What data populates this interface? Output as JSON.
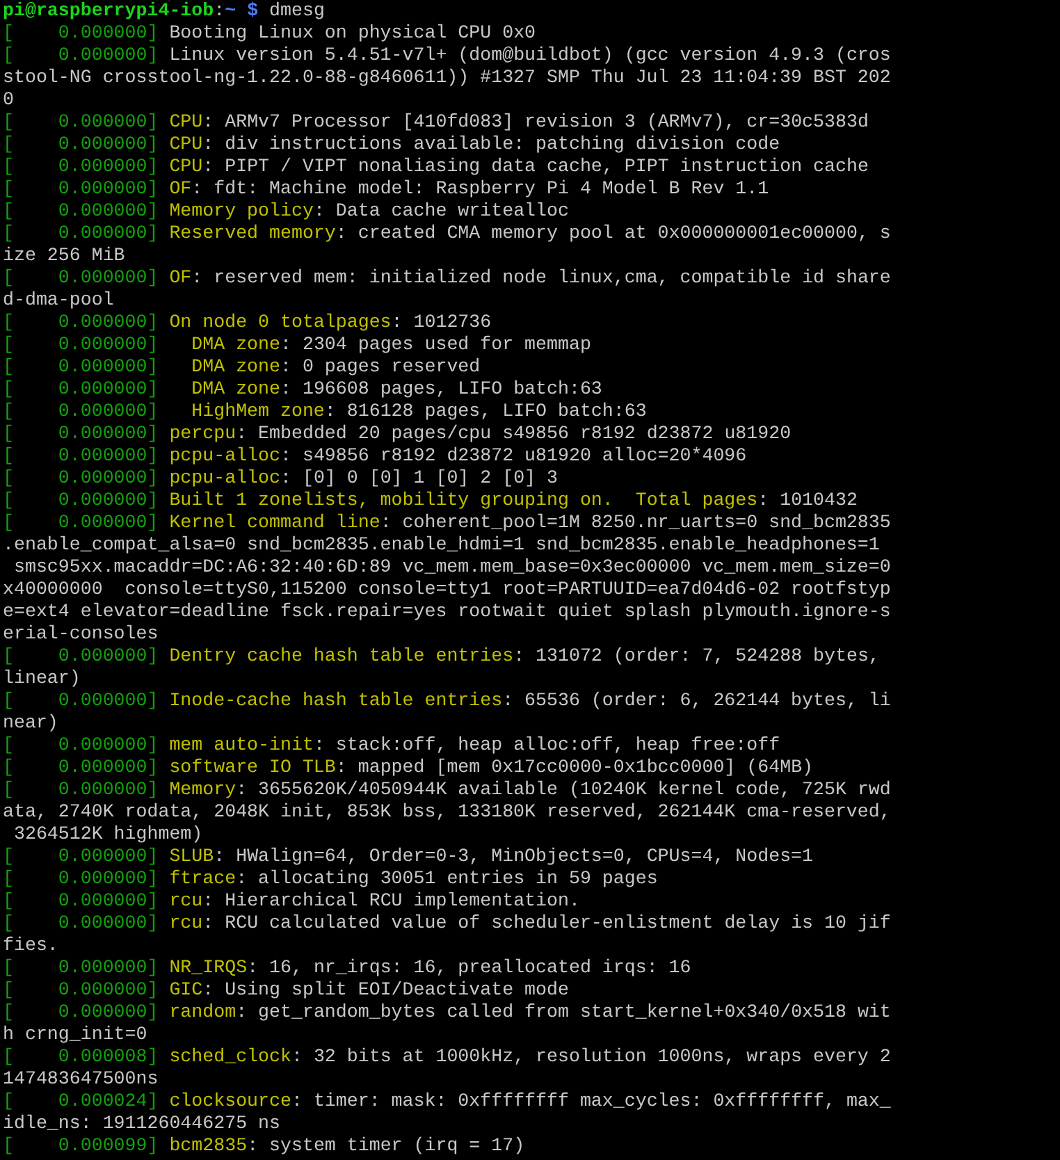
{
  "prompt": {
    "user_host": "pi@raspberrypi4-iob",
    "separator": ":",
    "path": "~",
    "symbol": "$",
    "command": "dmesg"
  },
  "log": [
    {
      "timestamp": "[    0.000000]",
      "message": "Booting Linux on physical CPU 0x0"
    },
    {
      "timestamp": "[    0.000000]",
      "message": "Linux version 5.4.51-v7l+ (dom@buildbot) (gcc version 4.9.3 (cros",
      "wrapped": [
        "stool-NG crosstool-ng-1.22.0-88-g8460611)) #1327 SMP Thu Jul 23 11:04:39 BST 202",
        "0"
      ]
    },
    {
      "timestamp": "[    0.000000]",
      "subsystem": "CPU",
      "message": ": ARMv7 Processor [410fd083] revision 3 (ARMv7), cr=30c5383d"
    },
    {
      "timestamp": "[    0.000000]",
      "subsystem": "CPU",
      "message": ": div instructions available: patching division code"
    },
    {
      "timestamp": "[    0.000000]",
      "subsystem": "CPU",
      "message": ": PIPT / VIPT nonaliasing data cache, PIPT instruction cache"
    },
    {
      "timestamp": "[    0.000000]",
      "subsystem": "OF",
      "message": ": fdt: Machine model: Raspberry Pi 4 Model B Rev 1.1"
    },
    {
      "timestamp": "[    0.000000]",
      "subsystem": "Memory policy",
      "message": ": Data cache writealloc"
    },
    {
      "timestamp": "[    0.000000]",
      "subsystem": "Reserved memory",
      "message": ": created CMA memory pool at 0x000000001ec00000, s",
      "wrapped": [
        "ize 256 MiB"
      ]
    },
    {
      "timestamp": "[    0.000000]",
      "subsystem": "OF",
      "message": ": reserved mem: initialized node linux,cma, compatible id share",
      "wrapped": [
        "d-dma-pool"
      ]
    },
    {
      "timestamp": "[    0.000000]",
      "subsystem": "On node 0 totalpages",
      "message": ": 1012736"
    },
    {
      "timestamp": "[    0.000000]",
      "subsystem": "  DMA zone",
      "message": ": 2304 pages used for memmap"
    },
    {
      "timestamp": "[    0.000000]",
      "subsystem": "  DMA zone",
      "message": ": 0 pages reserved"
    },
    {
      "timestamp": "[    0.000000]",
      "subsystem": "  DMA zone",
      "message": ": 196608 pages, LIFO batch:63"
    },
    {
      "timestamp": "[    0.000000]",
      "subsystem": "  HighMem zone",
      "message": ": 816128 pages, LIFO batch:63"
    },
    {
      "timestamp": "[    0.000000]",
      "subsystem": "percpu",
      "message": ": Embedded 20 pages/cpu s49856 r8192 d23872 u81920"
    },
    {
      "timestamp": "[    0.000000]",
      "subsystem": "pcpu-alloc",
      "message": ": s49856 r8192 d23872 u81920 alloc=20*4096"
    },
    {
      "timestamp": "[    0.000000]",
      "subsystem": "pcpu-alloc",
      "message": ": [0] 0 [0] 1 [0] 2 [0] 3"
    },
    {
      "timestamp": "[    0.000000]",
      "subsystem": "Built 1 zonelists, mobility grouping on.  Total pages",
      "message": ": 1010432"
    },
    {
      "timestamp": "[    0.000000]",
      "subsystem": "Kernel command line",
      "message": ": coherent_pool=1M 8250.nr_uarts=0 snd_bcm2835",
      "wrapped": [
        ".enable_compat_alsa=0 snd_bcm2835.enable_hdmi=1 snd_bcm2835.enable_headphones=1",
        " smsc95xx.macaddr=DC:A6:32:40:6D:89 vc_mem.mem_base=0x3ec00000 vc_mem.mem_size=0",
        "x40000000  console=ttyS0,115200 console=tty1 root=PARTUUID=ea7d04d6-02 rootfstyp",
        "e=ext4 elevator=deadline fsck.repair=yes rootwait quiet splash plymouth.ignore-s",
        "erial-consoles"
      ]
    },
    {
      "timestamp": "[    0.000000]",
      "subsystem": "Dentry cache hash table entries",
      "message": ": 131072 (order: 7, 524288 bytes,",
      "wrapped": [
        "linear)"
      ]
    },
    {
      "timestamp": "[    0.000000]",
      "subsystem": "Inode-cache hash table entries",
      "message": ": 65536 (order: 6, 262144 bytes, li",
      "wrapped": [
        "near)"
      ]
    },
    {
      "timestamp": "[    0.000000]",
      "subsystem": "mem auto-init",
      "message": ": stack:off, heap alloc:off, heap free:off"
    },
    {
      "timestamp": "[    0.000000]",
      "subsystem": "software IO TLB",
      "message": ": mapped [mem 0x17cc0000-0x1bcc0000] (64MB)"
    },
    {
      "timestamp": "[    0.000000]",
      "subsystem": "Memory",
      "message": ": 3655620K/4050944K available (10240K kernel code, 725K rwd",
      "wrapped": [
        "ata, 2740K rodata, 2048K init, 853K bss, 133180K reserved, 262144K cma-reserved,",
        " 3264512K highmem)"
      ]
    },
    {
      "timestamp": "[    0.000000]",
      "subsystem": "SLUB",
      "message": ": HWalign=64, Order=0-3, MinObjects=0, CPUs=4, Nodes=1"
    },
    {
      "timestamp": "[    0.000000]",
      "subsystem": "ftrace",
      "message": ": allocating 30051 entries in 59 pages"
    },
    {
      "timestamp": "[    0.000000]",
      "subsystem": "rcu",
      "message": ": Hierarchical RCU implementation."
    },
    {
      "timestamp": "[    0.000000]",
      "subsystem": "rcu",
      "message": ": RCU calculated value of scheduler-enlistment delay is 10 jif",
      "wrapped": [
        "fies."
      ]
    },
    {
      "timestamp": "[    0.000000]",
      "subsystem": "NR_IRQS",
      "message": ": 16, nr_irqs: 16, preallocated irqs: 16"
    },
    {
      "timestamp": "[    0.000000]",
      "subsystem": "GIC",
      "message": ": Using split EOI/Deactivate mode"
    },
    {
      "timestamp": "[    0.000000]",
      "subsystem": "random",
      "message": ": get_random_bytes called from start_kernel+0x340/0x518 wit",
      "wrapped": [
        "h crng_init=0"
      ]
    },
    {
      "timestamp": "[    0.000008]",
      "subsystem": "sched_clock",
      "message": ": 32 bits at 1000kHz, resolution 1000ns, wraps every 2",
      "wrapped": [
        "147483647500ns"
      ]
    },
    {
      "timestamp": "[    0.000024]",
      "subsystem": "clocksource",
      "message": ": timer: mask: 0xffffffff max_cycles: 0xffffffff, max_",
      "wrapped": [
        "idle_ns: 1911260446275 ns"
      ]
    },
    {
      "timestamp": "[    0.000099]",
      "subsystem": "bcm2835",
      "message": ": system timer (irq = 17)"
    }
  ]
}
